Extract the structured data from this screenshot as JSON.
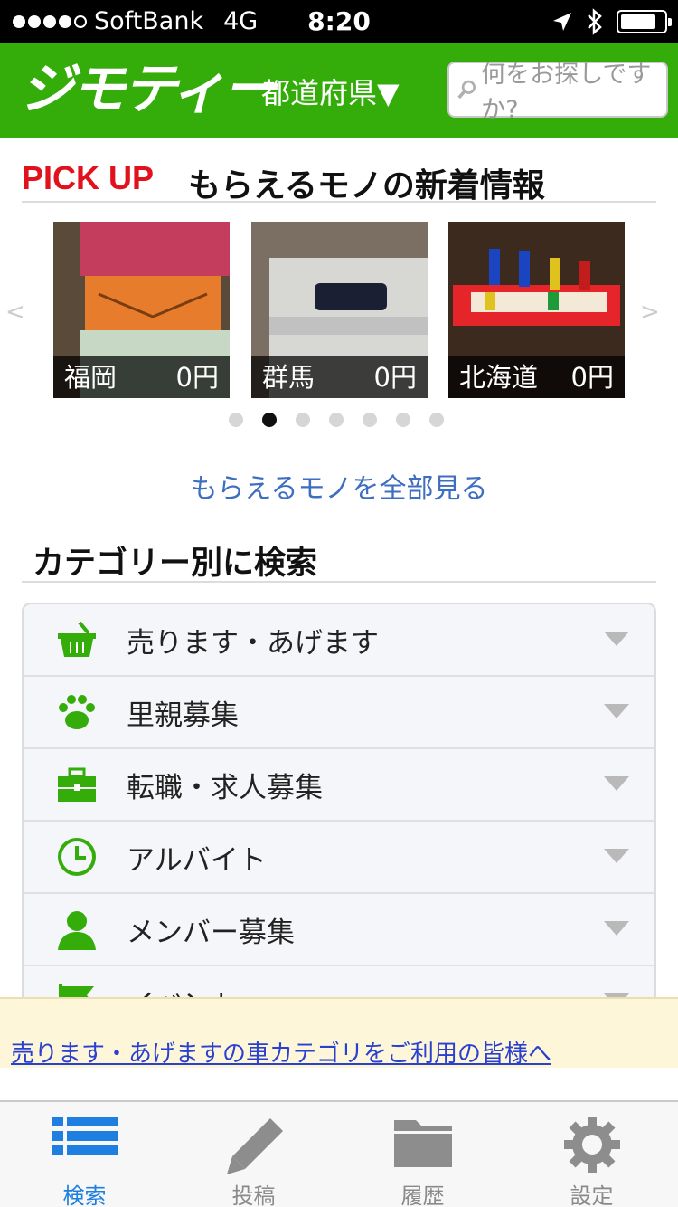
{
  "status": {
    "carrier": "SoftBank",
    "network": "4G",
    "time": "8:20",
    "signal_bars": 4,
    "signal_max": 5,
    "battery_level": 0.85
  },
  "header": {
    "logo": "ジモティー",
    "prefecture": "都道府県▼",
    "search_placeholder": "何をお探しですか?",
    "brand_color": "#34ad0b"
  },
  "pickup": {
    "badge": "PICK UP",
    "title": "もらえるモノの新着情報",
    "items": [
      {
        "location": "福岡",
        "price": "0円"
      },
      {
        "location": "群馬",
        "price": "0円"
      },
      {
        "location": "北海道",
        "price": "0円"
      }
    ],
    "page_count": 7,
    "active_page": 2,
    "see_all": "もらえるモノを全部見る"
  },
  "category": {
    "title": "カテゴリー別に検索",
    "items": [
      {
        "label": "売ります・あげます",
        "icon": "basket-icon"
      },
      {
        "label": "里親募集",
        "icon": "paw-icon"
      },
      {
        "label": "転職・求人募集",
        "icon": "toolbox-icon"
      },
      {
        "label": "アルバイト",
        "icon": "clock-icon"
      },
      {
        "label": "メンバー募集",
        "icon": "person-icon"
      },
      {
        "label": "イベント",
        "icon": "flag-icon"
      }
    ]
  },
  "notice": {
    "text": "売ります・あげますの車カテゴリをご利用の皆様へ"
  },
  "tabs": [
    {
      "label": "検索",
      "icon": "list-icon",
      "active": true
    },
    {
      "label": "投稿",
      "icon": "pencil-icon",
      "active": false
    },
    {
      "label": "履歴",
      "icon": "folder-icon",
      "active": false
    },
    {
      "label": "設定",
      "icon": "gear-icon",
      "active": false
    }
  ],
  "colors": {
    "accent": "#34ad0b",
    "pickup_red": "#e0121d",
    "link": "#3d6ec0",
    "tab_active": "#1f7fe0"
  }
}
